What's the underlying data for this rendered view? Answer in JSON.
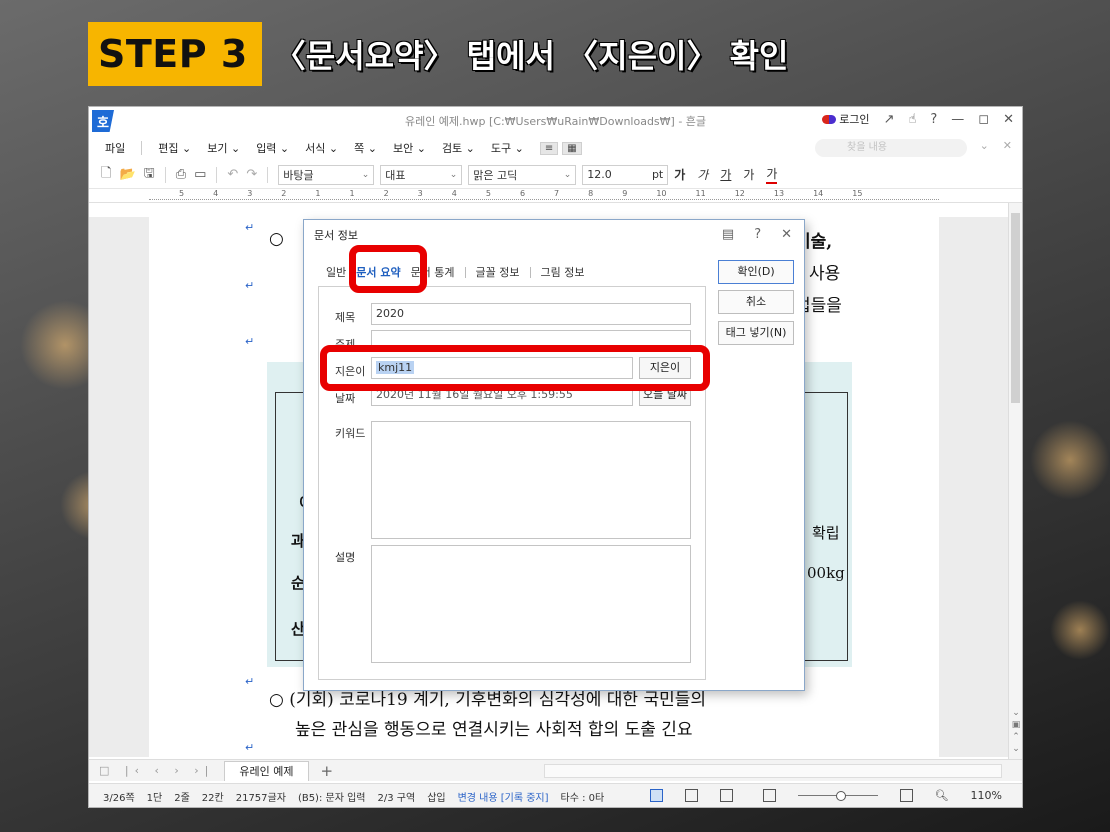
{
  "step": {
    "badge": "STEP 3",
    "text": "〈문서요약〉 탭에서 〈지은이〉 확인"
  },
  "window": {
    "title": "유레인 예제.hwp [C:₩Users₩uRain₩Downloads₩] - 흔글",
    "login": "로그인",
    "app_logo": "호",
    "controls": [
      "↗",
      "☝",
      "?",
      "—",
      "◻",
      "✕"
    ]
  },
  "menu": {
    "file": "파일",
    "items": [
      "편집 ⌄",
      "보기 ⌄",
      "입력 ⌄",
      "서식 ⌄",
      "쪽 ⌄",
      "보안 ⌄",
      "검토 ⌄",
      "도구 ⌄"
    ],
    "search_placeholder": "찾을 내용"
  },
  "toolbar": {
    "style": "바탕글",
    "rep": "대표",
    "font": "맑은 고딕",
    "size": "12.0",
    "unit": "pt",
    "fmt": [
      "가",
      "가",
      "가",
      "가",
      "가"
    ]
  },
  "ruler": [
    "5",
    "4",
    "3",
    "2",
    "1",
    "1",
    "2",
    "3",
    "4",
    "5",
    "6",
    "7",
    "8",
    "9",
    "10",
    "11",
    "12",
    "13",
    "14",
    "15"
  ],
  "doc": {
    "line1_marker": "○",
    "line1_text": "기술,",
    "line2_text": "사용",
    "line3_text": "업들을",
    "row_texts": [
      "확립",
      "00kg"
    ],
    "table_chars": [
      "이",
      "과",
      "순",
      "산"
    ],
    "bottom1": "○ (기회) 코로나19 계기, 기후변화의 심각성에 대한 국민들의",
    "bottom2": "높은 관심을 행동으로 연결시키는 사회적 합의 도출 긴요"
  },
  "dialog": {
    "title": "문서 정보",
    "tabs": [
      "일반",
      "문서 요약",
      "문서 통계",
      "글꼴 정보",
      "그림 정보"
    ],
    "labels": {
      "title": "제목",
      "subject": "주제",
      "author": "지은이",
      "date": "날짜",
      "keyword": "키워드",
      "desc": "설명"
    },
    "values": {
      "title": "2020",
      "subject": "",
      "author": "kmj11",
      "date": "2020년 11월 16일 월요일 오후 1:59:55"
    },
    "buttons": {
      "author": "지은이",
      "today": "오늘 날짜",
      "ok": "확인(D)",
      "cancel": "취소",
      "tag": "태그 넣기(N)"
    }
  },
  "tabbar": {
    "sheet": "유레인 예제",
    "add": "+"
  },
  "status": {
    "items": [
      "3/26쪽",
      "1단",
      "2줄",
      "22칸",
      "21757글자",
      "(B5): 문자 입력",
      "2/3 구역",
      "삽입"
    ],
    "track": "변경 내용 [기록 중지]",
    "taps": "타수 : 0타",
    "zoom": "110%"
  },
  "colors": {
    "accent": "#f7b500",
    "highlight": "#e80000",
    "brand": "#1e6bd6"
  }
}
